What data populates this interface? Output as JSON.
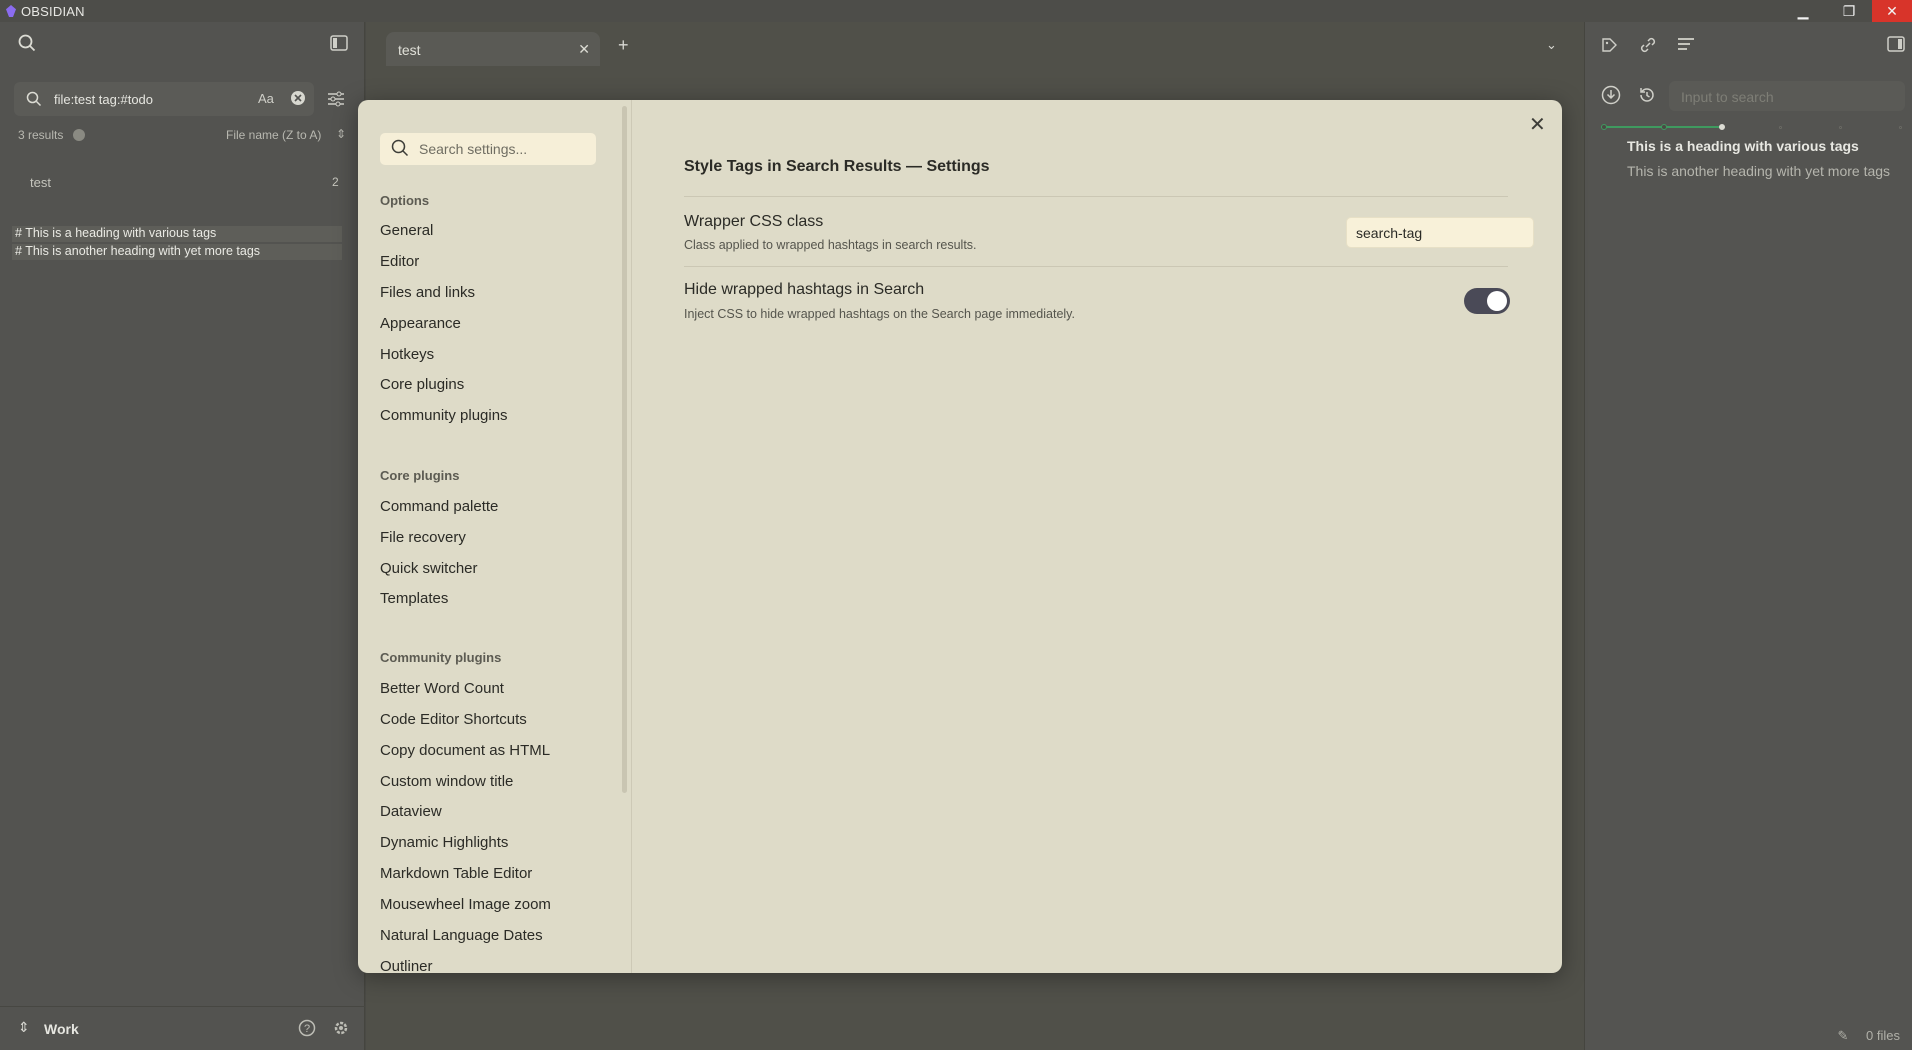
{
  "window": {
    "title": "OBSIDIAN",
    "minimize": "▁",
    "maximize": "❐",
    "close": "✕"
  },
  "left_panel": {
    "search_query": "file:test tag:#todo",
    "match_case": "Aa",
    "results_count": "3 results",
    "sort_label": "File name (Z to A)",
    "result_file": "test",
    "result_file_count": "2",
    "result_lines": [
      "# This is a heading with various tags",
      "# This is another heading with yet more tags"
    ],
    "vault_name": "Work"
  },
  "tabs": [
    {
      "label": "test"
    }
  ],
  "right_panel": {
    "search_placeholder": "Input to search",
    "headings": [
      "This is a heading with various tags",
      "This is another heading with yet more tags"
    ],
    "footer_files": "0 files"
  },
  "settings_modal": {
    "search_placeholder": "Search settings...",
    "sections": [
      {
        "title": "Options",
        "items": [
          "General",
          "Editor",
          "Files and links",
          "Appearance",
          "Hotkeys",
          "Core plugins",
          "Community plugins"
        ]
      },
      {
        "title": "Core plugins",
        "items": [
          "Command palette",
          "File recovery",
          "Quick switcher",
          "Templates"
        ]
      },
      {
        "title": "Community plugins",
        "items": [
          "Better Word Count",
          "Code Editor Shortcuts",
          "Copy document as HTML",
          "Custom window title",
          "Dataview",
          "Dynamic Highlights",
          "Markdown Table Editor",
          "Mousewheel Image zoom",
          "Natural Language Dates",
          "Outliner"
        ]
      }
    ],
    "page_title": "Style Tags in Search Results — Settings",
    "settings": [
      {
        "name": "Wrapper CSS class",
        "description": "Class applied to wrapped hashtags in search results.",
        "value": "search-tag"
      },
      {
        "name": "Hide wrapped hashtags in Search",
        "description": "Inject CSS to hide wrapped hashtags on the Search page immediately.",
        "toggle_on": true
      }
    ]
  },
  "colors": {
    "accent_green": "#3f9a5f",
    "modal_bg": "#dedbc8",
    "toggle_on": "#4a4a57",
    "close_red": "#d8342a"
  }
}
